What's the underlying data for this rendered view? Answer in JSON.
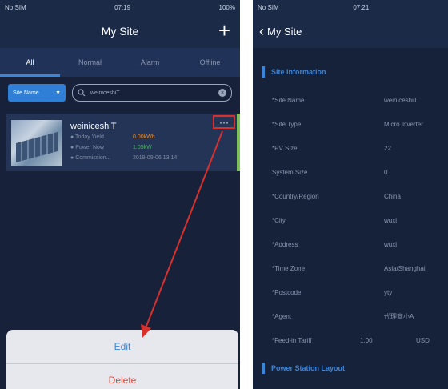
{
  "left": {
    "status": {
      "carrier": "No SIM",
      "time": "07:19",
      "battery": "100%"
    },
    "title": "My Site",
    "tabs": [
      {
        "label": "All"
      },
      {
        "label": "Normal"
      },
      {
        "label": "Alarm"
      },
      {
        "label": "Offline"
      }
    ],
    "filter": {
      "dropdown_label": "Site Name",
      "search_value": "weiniceshiT"
    },
    "site": {
      "name": "weiniceshiT",
      "today_yield_label": "Today Yield",
      "today_yield_value": "0.00kWh",
      "power_now_label": "Power Now",
      "power_now_value": "1.05kW",
      "commission_label": "Commission...",
      "commission_value": "2019-09-06 13:14"
    },
    "more_label": "···",
    "sheet": {
      "edit_label": "Edit",
      "delete_label": "Delete"
    },
    "colors": {
      "accent": "#3b86d8",
      "highlight": "#d9302c",
      "delete": "#e0433a"
    }
  },
  "right": {
    "status": {
      "carrier": "No SIM",
      "time": "07:21"
    },
    "back_label": "My Site",
    "section_info": "Site Information",
    "rows": [
      {
        "label": "*Site Name",
        "value": "weiniceshiT"
      },
      {
        "label": "*Site Type",
        "value": "Micro Inverter"
      },
      {
        "label": "*PV Size",
        "value": "22"
      },
      {
        "label": "System Size",
        "value": "0"
      },
      {
        "label": "*Country/Region",
        "value": "China"
      },
      {
        "label": "*City",
        "value": "wuxi"
      },
      {
        "label": "*Address",
        "value": "wuxi"
      },
      {
        "label": "*Time Zone",
        "value": "Asia/Shanghai"
      },
      {
        "label": "*Postcode",
        "value": "yty"
      },
      {
        "label": "*Agent",
        "value": "代理商小A"
      },
      {
        "label": "*Feed-in Tariff",
        "value": "1.00",
        "unit": "USD"
      }
    ],
    "section_layout": "Power Station Layout"
  }
}
